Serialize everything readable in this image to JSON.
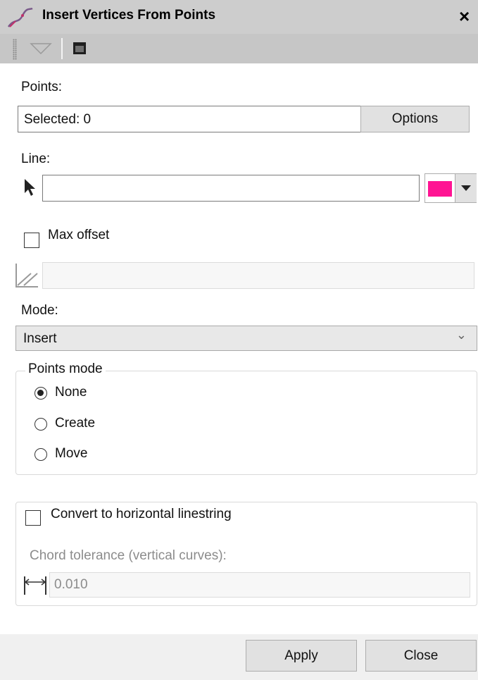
{
  "window": {
    "title": "Insert Vertices From Points",
    "close_label": "×"
  },
  "points": {
    "label": "Points:",
    "selected_value": "Selected: 0",
    "options_button": "Options"
  },
  "line": {
    "label": "Line:",
    "value": "",
    "color": "#ff1493"
  },
  "max_offset": {
    "label": "Max offset",
    "checked": false,
    "value": ""
  },
  "mode": {
    "label": "Mode:",
    "selected": "Insert",
    "chevron": "⌄"
  },
  "points_mode": {
    "legend": "Points mode",
    "options": [
      {
        "label": "None",
        "selected": true
      },
      {
        "label": "Create",
        "selected": false
      },
      {
        "label": "Move",
        "selected": false
      }
    ]
  },
  "horizontal": {
    "checkbox_label": "Convert to horizontal linestring",
    "checked": false,
    "chord_label": "Chord tolerance (vertical curves):",
    "chord_value": "0.010"
  },
  "footer": {
    "apply_button": "Apply",
    "close_button": "Close"
  }
}
